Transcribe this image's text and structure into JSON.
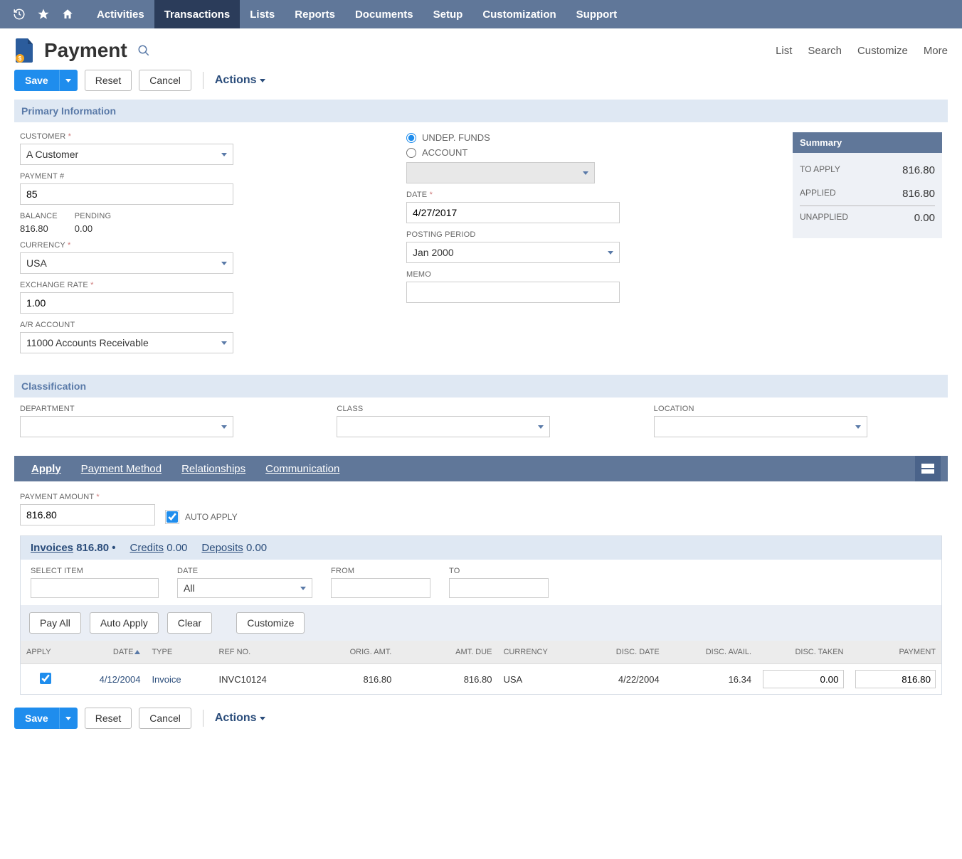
{
  "nav": {
    "items": [
      "Activities",
      "Transactions",
      "Lists",
      "Reports",
      "Documents",
      "Setup",
      "Customization",
      "Support"
    ],
    "active_index": 1
  },
  "page": {
    "title": "Payment",
    "links": [
      "List",
      "Search",
      "Customize",
      "More"
    ],
    "save": "Save",
    "reset": "Reset",
    "cancel": "Cancel",
    "actions": "Actions"
  },
  "sections": {
    "primary": "Primary Information",
    "classification": "Classification"
  },
  "fields": {
    "customer_label": "CUSTOMER",
    "customer_value": "A Customer",
    "paymentno_label": "PAYMENT #",
    "paymentno_value": "85",
    "balance_label": "BALANCE",
    "balance_value": "816.80",
    "pending_label": "PENDING",
    "pending_value": "0.00",
    "currency_label": "CURRENCY",
    "currency_value": "USA",
    "exrate_label": "EXCHANGE RATE",
    "exrate_value": "1.00",
    "ar_label": "A/R ACCOUNT",
    "ar_value": "11000 Accounts Receivable",
    "undep_label": "UNDEP. FUNDS",
    "account_label": "ACCOUNT",
    "date_label": "DATE",
    "date_value": "4/27/2017",
    "posting_label": "POSTING PERIOD",
    "posting_value": "Jan 2000",
    "memo_label": "MEMO",
    "department_label": "DEPARTMENT",
    "class_label": "CLASS",
    "location_label": "LOCATION"
  },
  "summary": {
    "title": "Summary",
    "to_apply_label": "TO APPLY",
    "to_apply_value": "816.80",
    "applied_label": "APPLIED",
    "applied_value": "816.80",
    "unapplied_label": "UNAPPLIED",
    "unapplied_value": "0.00"
  },
  "subtabs": {
    "items": [
      "Apply",
      "Payment Method",
      "Relationships",
      "Communication"
    ],
    "active_index": 0
  },
  "apply": {
    "amount_label": "PAYMENT AMOUNT",
    "amount_value": "816.80",
    "auto_apply_label": "AUTO APPLY",
    "inner_tabs": {
      "invoices_label": "Invoices",
      "invoices_amt": "816.80",
      "credits_label": "Credits",
      "credits_amt": "0.00",
      "deposits_label": "Deposits",
      "deposits_amt": "0.00"
    },
    "filters": {
      "select_item": "SELECT ITEM",
      "date": "DATE",
      "date_value": "All",
      "from": "FROM",
      "to": "TO"
    },
    "buttons": {
      "pay_all": "Pay All",
      "auto_apply": "Auto Apply",
      "clear": "Clear",
      "customize": "Customize"
    },
    "columns": [
      "APPLY",
      "DATE",
      "TYPE",
      "REF NO.",
      "ORIG. AMT.",
      "AMT. DUE",
      "CURRENCY",
      "DISC. DATE",
      "DISC. AVAIL.",
      "DISC. TAKEN",
      "PAYMENT"
    ],
    "row": {
      "apply_checked": true,
      "date": "4/12/2004",
      "type": "Invoice",
      "refno": "INVC10124",
      "orig_amt": "816.80",
      "amt_due": "816.80",
      "currency": "USA",
      "disc_date": "4/22/2004",
      "disc_avail": "16.34",
      "disc_taken": "0.00",
      "payment": "816.80"
    }
  }
}
